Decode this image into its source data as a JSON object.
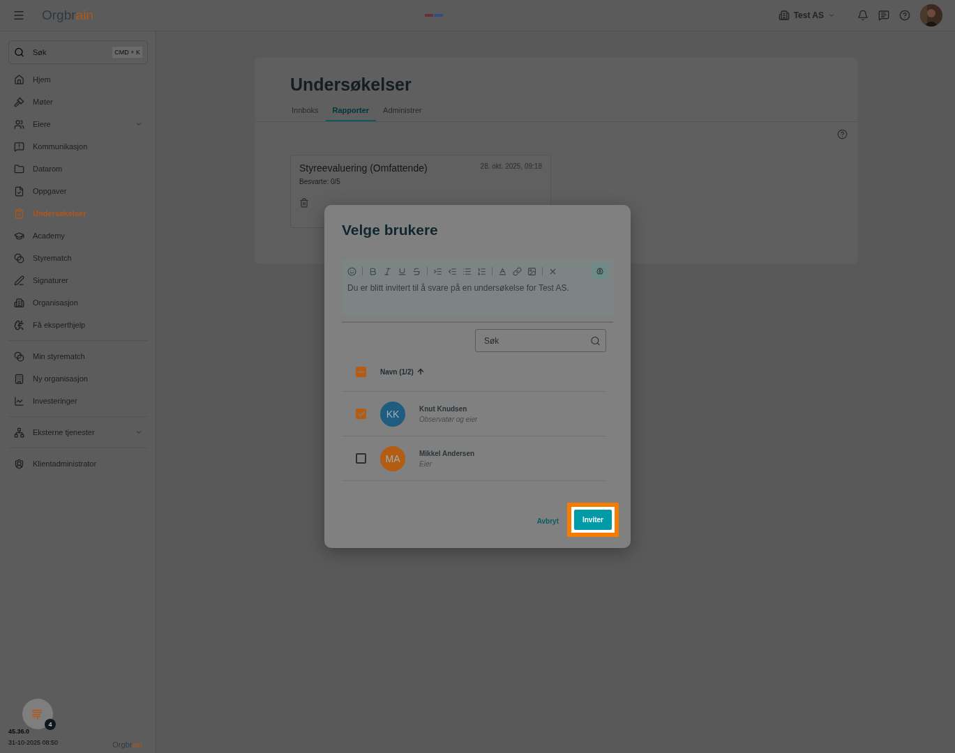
{
  "topbar": {
    "logo_main": "Orgbr",
    "logo_accent": "ain",
    "organization": "Test AS"
  },
  "sidebar": {
    "search": {
      "placeholder": "Søk",
      "shortcut": "CMD + K"
    },
    "groups": [
      {
        "items": [
          {
            "label": "Hjem",
            "kind": "link",
            "selected": false
          },
          {
            "label": "Møter",
            "kind": "link",
            "selected": false
          },
          {
            "label": "Eiere",
            "kind": "group",
            "selected": false
          },
          {
            "label": "Kommunikasjon",
            "kind": "link",
            "selected": false
          },
          {
            "label": "Datarom",
            "kind": "link",
            "selected": false
          },
          {
            "label": "Oppgaver",
            "kind": "link",
            "selected": false
          },
          {
            "label": "Undersøkelser",
            "kind": "link",
            "selected": true
          },
          {
            "label": "Academy",
            "kind": "link",
            "selected": false
          },
          {
            "label": "Styrematch",
            "kind": "link",
            "selected": false
          },
          {
            "label": "Signaturer",
            "kind": "link",
            "selected": false
          },
          {
            "label": "Organisasjon",
            "kind": "link",
            "selected": false
          },
          {
            "label": "Få eksperthjelp",
            "kind": "link",
            "selected": false
          }
        ]
      },
      {
        "items": [
          {
            "label": "Min styrematch",
            "kind": "link",
            "selected": false
          },
          {
            "label": "Ny organisasjon",
            "kind": "link",
            "selected": false
          },
          {
            "label": "Investeringer",
            "kind": "link",
            "selected": false
          }
        ]
      },
      {
        "items": [
          {
            "label": "Eksterne tjenester",
            "kind": "group",
            "selected": false
          }
        ]
      },
      {
        "items": [
          {
            "label": "Klientadministrator",
            "kind": "link",
            "selected": false
          }
        ]
      }
    ],
    "help_badge": "4",
    "version": "45.36.0",
    "build_date": "31-10-2025 08:50",
    "footer_logo_main": "Orgbr",
    "footer_logo_accent": "ain"
  },
  "page": {
    "title": "Undersøkelser",
    "tabs": [
      {
        "label": "Innboks",
        "selected": false
      },
      {
        "label": "Rapporter",
        "selected": true
      },
      {
        "label": "Administrer",
        "selected": false
      }
    ],
    "survey_card": {
      "title": "Styreevaluering (Omfattende)",
      "date": "28. okt. 2025, 09:18",
      "answered": "Besvarte: 0/5"
    }
  },
  "dialog": {
    "title": "Velge brukere",
    "message": "Du er blitt invitert til å svare på en undersøkelse for Test AS.",
    "search": {
      "placeholder": "Søk"
    },
    "select_all": {
      "checked": true,
      "partial": true
    },
    "column": "Navn (1/2)",
    "users": [
      {
        "initials": "KK",
        "name": "Knut Knudsen",
        "role": "Observatør og eier",
        "checked": true,
        "color": "#1e5c80"
      },
      {
        "initials": "MA",
        "name": "Mikkel Andersen",
        "role": "Eier",
        "checked": false,
        "color": "#b35c12"
      }
    ],
    "buttons": [
      {
        "label": "Avbryt",
        "kind": "text",
        "highlighted": false
      },
      {
        "label": "Inviter",
        "kind": "primary",
        "highlighted": true
      }
    ]
  }
}
